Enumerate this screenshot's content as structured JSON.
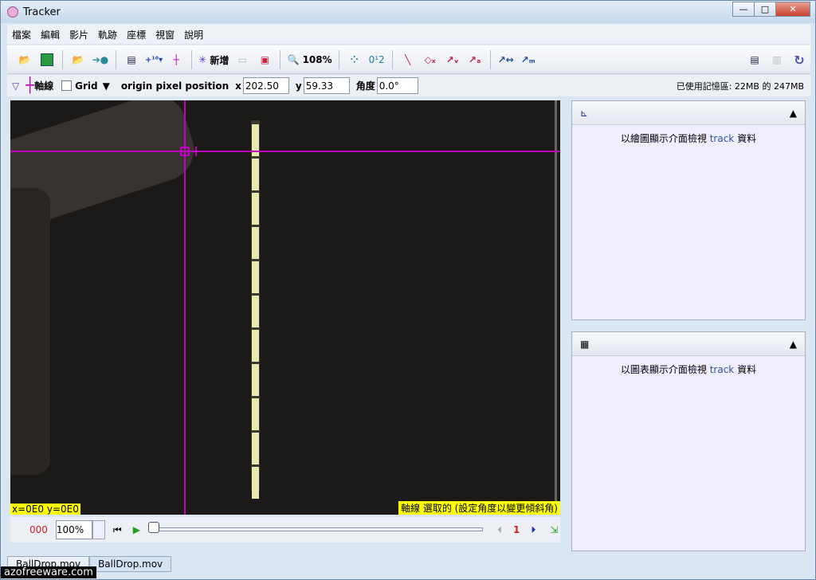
{
  "window": {
    "title": "Tracker",
    "min": "—",
    "max": "□",
    "close": "✕"
  },
  "menu": [
    "檔案",
    "編輯",
    "影片",
    "軌跡",
    "座標",
    "視窗",
    "說明"
  ],
  "toolbar": {
    "new_label": "新增",
    "zoom_label": "108%",
    "icons": [
      "open-icon",
      "save-icon",
      "open-video-icon",
      "import-icon",
      "clip-settings-icon",
      "calibration-icon",
      "axes-icon",
      "new-track-icon",
      "ruler-icon",
      "snapshot-icon",
      "zoom-icon",
      "trails-icon",
      "labels-icon",
      "path-icon",
      "position-icon",
      "velocity-icon",
      "acceleration-icon",
      "vector-sum-icon",
      "center-mass-icon",
      "notes-icon",
      "properties-icon",
      "refresh-icon"
    ]
  },
  "axesbar": {
    "axes_label": "軸線",
    "grid_label": "Grid",
    "origin_label": "origin pixel position",
    "x_label": "x",
    "x_value": "202.50",
    "y_label": "y",
    "y_value": "59.33",
    "angle_label": "角度",
    "angle_value": "0.0°",
    "memory": "已使用記憶區: 22MB 的 247MB"
  },
  "video": {
    "readout": "x=0E0  y=0E0",
    "status": "軸線 選取的 (設定角度以變更傾斜角)"
  },
  "player": {
    "frame": "000",
    "rate": "100%",
    "step": "1"
  },
  "plot_panel": {
    "text": "以繪圖顯示介面檢視 ",
    "track": "track",
    "suffix": " 資料"
  },
  "table_panel": {
    "text": "以圖表顯示介面檢視 ",
    "track": "track",
    "suffix": " 資料"
  },
  "tabs": [
    "BallDrop.mov",
    "BallDrop.mov"
  ],
  "watermark": "azofreeware.com"
}
